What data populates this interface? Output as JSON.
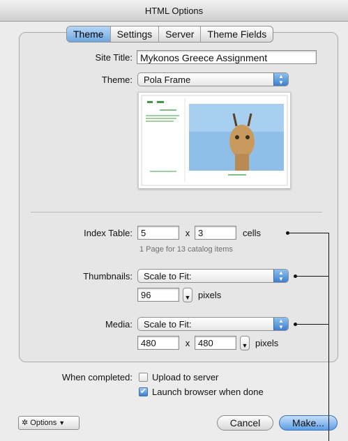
{
  "window": {
    "title": "HTML Options"
  },
  "tabs": [
    {
      "label": "Theme",
      "selected": true
    },
    {
      "label": "Settings",
      "selected": false
    },
    {
      "label": "Server",
      "selected": false
    },
    {
      "label": "Theme Fields",
      "selected": false
    }
  ],
  "site_title": {
    "label": "Site Title:",
    "value": "Mykonos Greece Assignment"
  },
  "theme": {
    "label": "Theme:",
    "value": "Pola Frame"
  },
  "index_table": {
    "label": "Index Table:",
    "columns": "5",
    "times": "x",
    "rows": "3",
    "unit": "cells",
    "hint": "1 Page for 13 catalog items"
  },
  "thumbnails": {
    "label": "Thumbnails:",
    "mode": "Scale to Fit:",
    "size": "96",
    "unit": "pixels"
  },
  "media": {
    "label": "Media:",
    "mode": "Scale to Fit:",
    "width": "480",
    "times": "x",
    "height": "480",
    "unit": "pixels"
  },
  "completion": {
    "label": "When completed:",
    "upload_label": "Upload to server",
    "upload_checked": false,
    "launch_label": "Launch browser when done",
    "launch_checked": true
  },
  "footer": {
    "options_label": "Options",
    "cancel_label": "Cancel",
    "make_label": "Make..."
  },
  "colors": {
    "accent": "#5c9ee6",
    "panel": "#e6e6e6"
  }
}
